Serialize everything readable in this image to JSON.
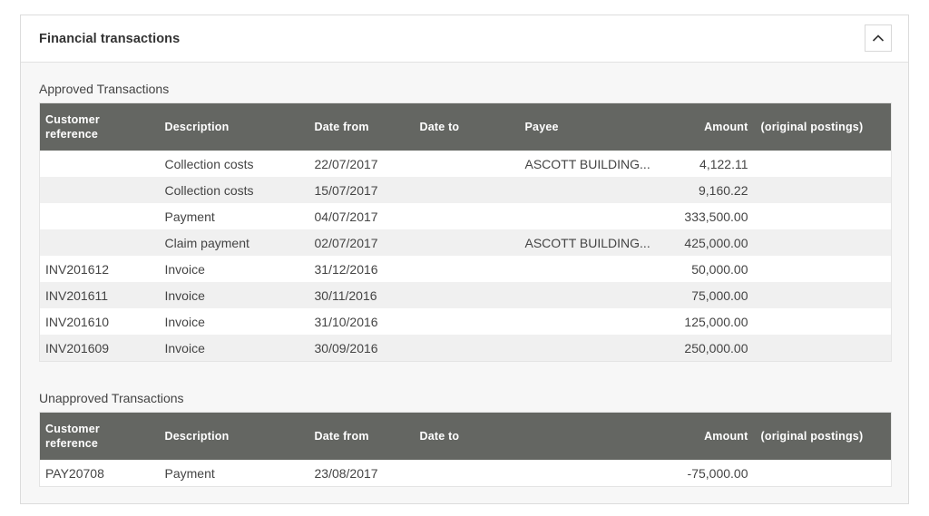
{
  "panel": {
    "title": "Financial transactions",
    "collapse_icon": "chevron-up-icon"
  },
  "approved": {
    "label": "Approved Transactions",
    "columns": [
      "Customer reference",
      "Description",
      "Date from",
      "Date to",
      "Payee",
      "Amount",
      "(original postings)"
    ],
    "rows": [
      {
        "ref": "",
        "description": "Collection costs",
        "date_from": "22/07/2017",
        "date_to": "",
        "payee": "ASCOTT BUILDING...",
        "amount": "4,122.11",
        "original": ""
      },
      {
        "ref": "",
        "description": "Collection costs",
        "date_from": "15/07/2017",
        "date_to": "",
        "payee": "",
        "amount": "9,160.22",
        "original": ""
      },
      {
        "ref": "",
        "description": "Payment",
        "date_from": "04/07/2017",
        "date_to": "",
        "payee": "",
        "amount": "333,500.00",
        "original": ""
      },
      {
        "ref": "",
        "description": "Claim payment",
        "date_from": "02/07/2017",
        "date_to": "",
        "payee": "ASCOTT BUILDING...",
        "amount": "425,000.00",
        "original": ""
      },
      {
        "ref": "INV201612",
        "description": "Invoice",
        "date_from": "31/12/2016",
        "date_to": "",
        "payee": "",
        "amount": "50,000.00",
        "original": ""
      },
      {
        "ref": "INV201611",
        "description": "Invoice",
        "date_from": "30/11/2016",
        "date_to": "",
        "payee": "",
        "amount": "75,000.00",
        "original": ""
      },
      {
        "ref": "INV201610",
        "description": "Invoice",
        "date_from": "31/10/2016",
        "date_to": "",
        "payee": "",
        "amount": "125,000.00",
        "original": ""
      },
      {
        "ref": "INV201609",
        "description": "Invoice",
        "date_from": "30/09/2016",
        "date_to": "",
        "payee": "",
        "amount": "250,000.00",
        "original": ""
      }
    ]
  },
  "unapproved": {
    "label": "Unapproved Transactions",
    "columns": [
      "Customer reference",
      "Description",
      "Date from",
      "Date to",
      "",
      "Amount",
      "(original postings)"
    ],
    "rows": [
      {
        "ref": "PAY20708",
        "description": "Payment",
        "date_from": "23/08/2017",
        "date_to": "",
        "payee": "",
        "amount": "-75,000.00",
        "original": ""
      }
    ]
  }
}
